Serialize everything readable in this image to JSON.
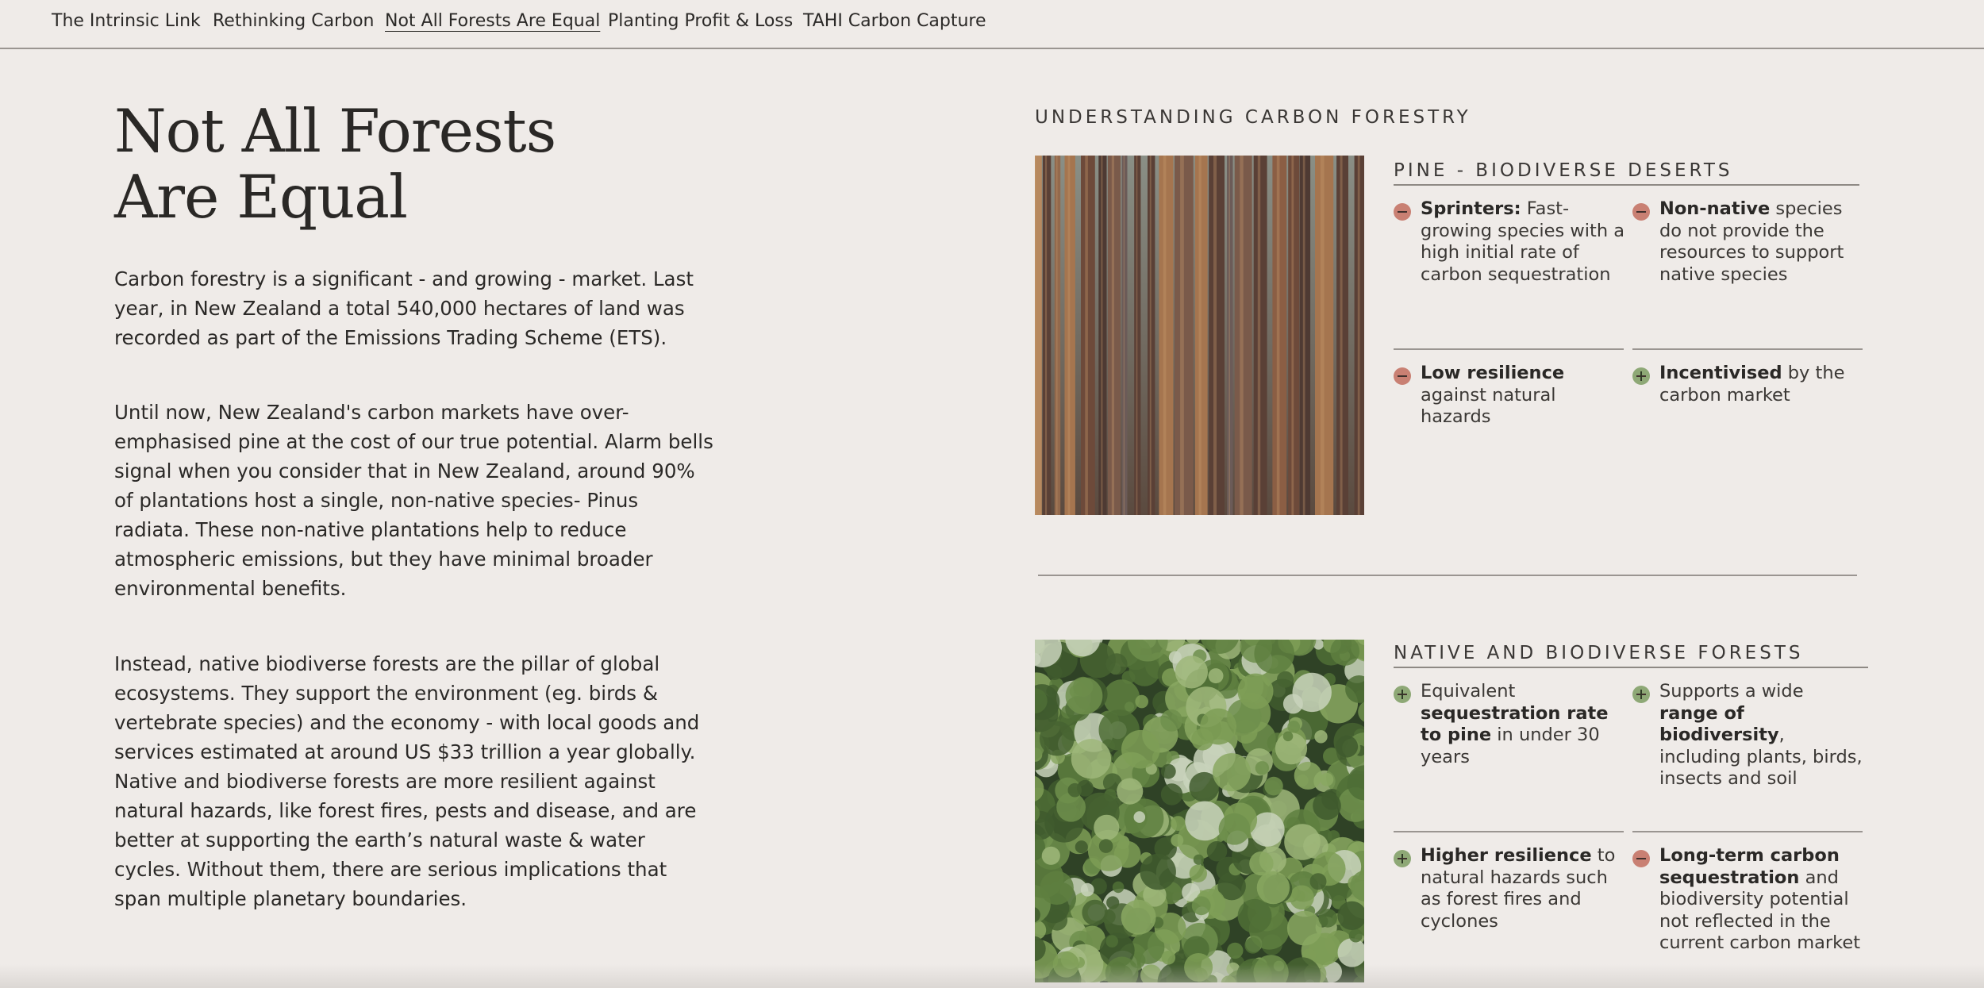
{
  "nav": {
    "items": [
      {
        "label": "The Intrinsic Link",
        "active": false
      },
      {
        "label": "Rethinking Carbon",
        "active": false
      },
      {
        "label": "Not All Forests Are Equal",
        "active": true
      },
      {
        "label": "Planting Profit & Loss",
        "active": false
      },
      {
        "label": "TAHI Carbon Capture",
        "active": false
      }
    ]
  },
  "main": {
    "title_line1": "Not All Forests",
    "title_line2": "Are Equal",
    "paragraphs": [
      "Carbon forestry is a significant - and growing - market. Last year, in New Zealand a total 540,000 hectares of land was recorded as part of the Emissions Trading Scheme (ETS).",
      "Until now, New Zealand's carbon markets have over-emphasised pine at the cost of our true potential. Alarm bells signal when you consider that in New Zealand, around 90% of plantations host a single, non-native species- Pinus radiata. These non-native plantations help to reduce atmospheric emissions, but they have minimal broader environmental benefits.",
      "Instead, native biodiverse forests are the pillar of global ecosystems. They support the environment (eg. birds & vertebrate species) and the economy - with local goods and services estimated at around US $33 trillion a year globally. Native and biodiverse forests are more resilient against natural hazards, like forest fires, pests and disease, and are better at supporting the earth’s natural waste & water cycles. Without them, there are serious implications that span multiple planetary boundaries."
    ]
  },
  "aside": {
    "heading": "UNDERSTANDING CARBON FORESTRY",
    "pine": {
      "title": "PINE - BIODIVERSE DESERTS",
      "features": [
        {
          "sign": "minus",
          "bold": "Sprinters:",
          "text": " Fast-growing species with a high initial rate of carbon sequestration"
        },
        {
          "sign": "minus",
          "bold": "Non-native",
          "text": " species do not provide the resources to support native species"
        },
        {
          "sign": "minus",
          "bold": "Low resilience",
          "text": " against natural hazards"
        },
        {
          "sign": "plus",
          "bold": "Incentivised",
          "text": " by the carbon market"
        }
      ]
    },
    "native": {
      "title": "NATIVE AND BIODIVERSE FORESTS",
      "features": [
        {
          "sign": "plus",
          "pre": "Equivalent ",
          "bold": "sequestration rate to pine",
          "text": " in under 30 years"
        },
        {
          "sign": "plus",
          "pre": "Supports a wide ",
          "bold": "range of biodiversity",
          "text": ", including plants, birds, insects and soil"
        },
        {
          "sign": "plus",
          "pre": "",
          "bold": "Higher resilience",
          "text": " to natural hazards such as forest fires and cyclones"
        },
        {
          "sign": "minus",
          "pre": "",
          "bold": "Long-term carbon sequestration",
          "text": " and biodiversity potential not reflected in the current carbon market"
        }
      ]
    }
  },
  "colors": {
    "background": "#efebe8",
    "minus_sign": "#c98073",
    "plus_sign": "#8ea876",
    "rule": "#9a9591"
  }
}
